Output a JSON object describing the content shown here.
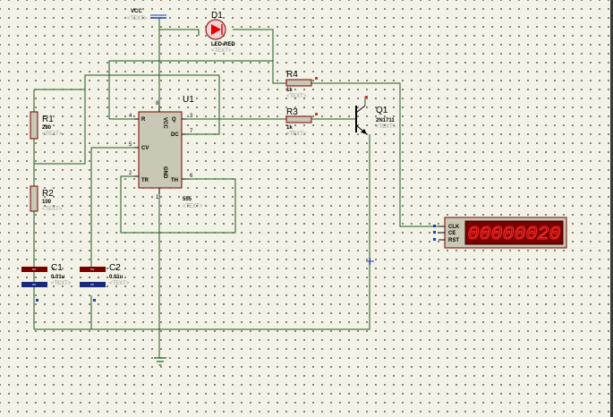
{
  "power": {
    "vcc_label": "VCC",
    "vcc_text": "<TEXT>"
  },
  "d1": {
    "ref": "D1",
    "value": "LED-RED",
    "text": "<TEXT>"
  },
  "r4": {
    "ref": "R4",
    "value": "1k",
    "text": "<TEXT>"
  },
  "r3": {
    "ref": "R3",
    "value": "1k",
    "text": "<TEXT>"
  },
  "q1": {
    "ref": "Q1",
    "value": "2N1711",
    "text": "<TEXT>"
  },
  "r1": {
    "ref": "R1",
    "value": "280",
    "text": "<TEXT>"
  },
  "r2": {
    "ref": "R2",
    "value": "100",
    "text": "<TEXT>"
  },
  "c1": {
    "ref": "C1",
    "value": "0.01u",
    "text": "<TEXT>"
  },
  "c2": {
    "ref": "C2",
    "value": "0.01u",
    "text": "<TEXT>"
  },
  "u1": {
    "ref": "U1",
    "value": "555",
    "text": "<TEXT>",
    "pins": {
      "r": "R",
      "vcc": "VCC",
      "q": "Q",
      "dc": "DC",
      "cv": "CV",
      "tr": "TR",
      "gnd": "GND",
      "th": "TH"
    },
    "pin_numbers": {
      "r": "4",
      "vcc": "8",
      "q": "3",
      "dc": "7",
      "cv": "5",
      "tr": "2",
      "gnd": "1",
      "th": "6"
    }
  },
  "counter": {
    "pins": {
      "clk": "CLK",
      "ce": "CE",
      "rst": "RST"
    },
    "display": "00000020"
  },
  "colors": {
    "background": "#f2f2e6",
    "wire": "#1d5a1d",
    "component_body": "#c8c8b4",
    "component_outline": "#7a0000",
    "led": "#e00000",
    "display_bg": "#7a0000",
    "display_digits": "#ff2a2a",
    "pin_marker": "#e03030",
    "node_marker": "#2040c0"
  }
}
